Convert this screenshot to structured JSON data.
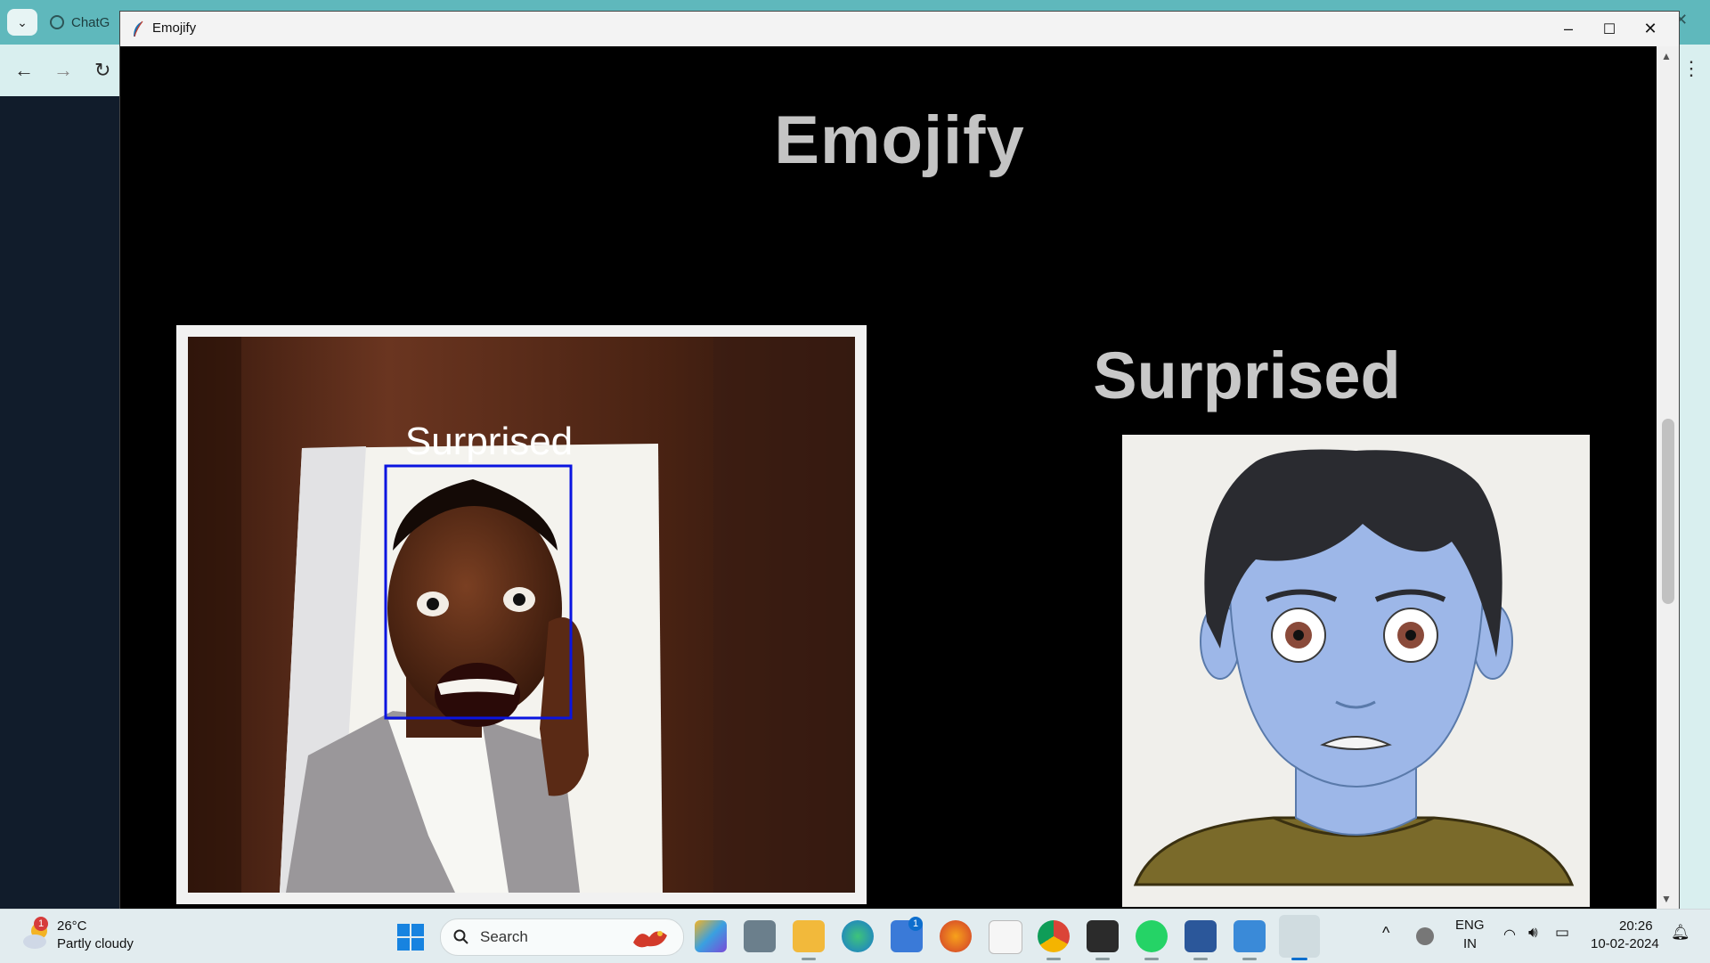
{
  "background_browser": {
    "tab_title": "ChatG"
  },
  "window": {
    "title": "Emojify",
    "minimize": "–",
    "maximize": "☐",
    "close": "✕"
  },
  "app": {
    "heading": "Emojify",
    "camera_overlay_label": "Surprised",
    "detected_emotion": "Surprised"
  },
  "taskbar": {
    "weather": {
      "temperature": "26°C",
      "condition": "Partly cloudy",
      "alert_count": "1"
    },
    "search_label": "Search",
    "store_badge": "1",
    "language": "ENG",
    "region": "IN",
    "time": "20:26",
    "date": "10-02-2024"
  },
  "colors": {
    "face_box": "#0a14e0",
    "emoji_skin": "#9db7e8",
    "heading": "#c4c4c4"
  }
}
